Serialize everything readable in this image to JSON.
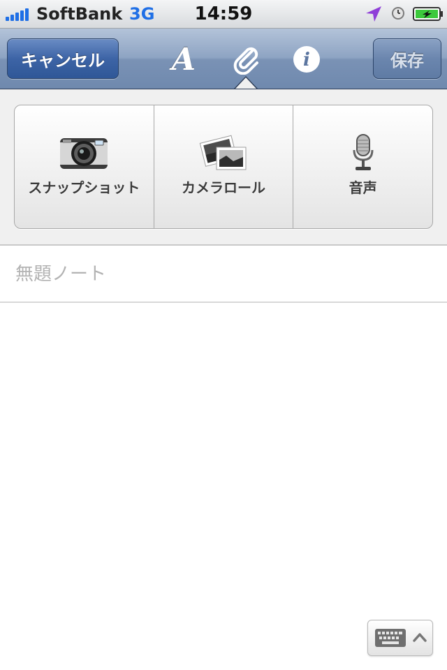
{
  "status_bar": {
    "carrier": "SoftBank",
    "network": "3G",
    "time": "14:59",
    "signal_bars": 5,
    "battery_state": "charging",
    "icons": [
      "signal-icon",
      "location-arrow-icon",
      "alarm-clock-icon",
      "battery-charging-icon"
    ],
    "colors": {
      "network": "#1f6fe6",
      "location_arrow": "#8f3fd8",
      "battery_fill": "#3cc93c"
    }
  },
  "nav_bar": {
    "cancel_label": "キャンセル",
    "save_label": "保存",
    "tools": [
      {
        "icon": "font-icon",
        "glyph": "A"
      },
      {
        "icon": "paperclip-icon",
        "selected": true
      },
      {
        "icon": "info-icon",
        "glyph": "i"
      }
    ],
    "colors": {
      "bar": "#8ea4c3",
      "cancel_button": "#3d64a6",
      "save_button": "#6b86ae"
    }
  },
  "attachment_panel": {
    "items": [
      {
        "label": "スナップショット",
        "icon": "camera-icon"
      },
      {
        "label": "カメラロール",
        "icon": "photos-icon"
      },
      {
        "label": "音声",
        "icon": "microphone-icon"
      }
    ]
  },
  "note": {
    "title_placeholder": "無題ノート",
    "title_value": "",
    "body_value": ""
  },
  "keyboard_toggle": {
    "icons": [
      "keyboard-icon",
      "chevron-up-icon"
    ]
  }
}
